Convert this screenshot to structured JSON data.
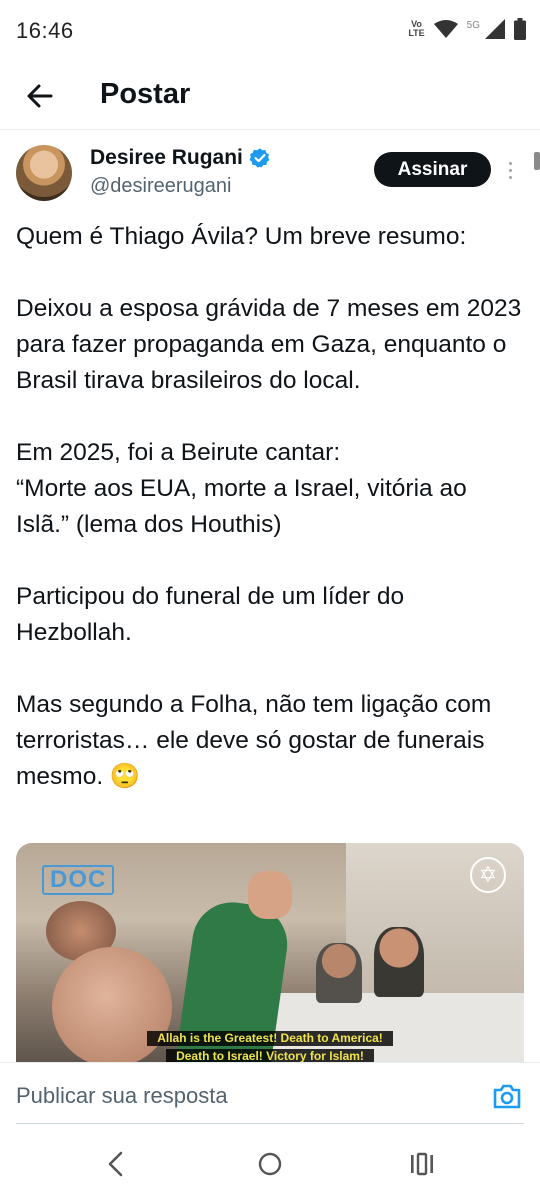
{
  "status_bar": {
    "time": "16:46",
    "volte_label": "Vo\nLTE",
    "network": "5G",
    "icons": [
      "volte-icon",
      "wifi-icon",
      "signal-icon",
      "battery-icon"
    ]
  },
  "header": {
    "back_icon": "arrow-left-icon",
    "title": "Postar"
  },
  "post": {
    "author_name": "Desiree Rugani",
    "verified": true,
    "handle": "@desireerugani",
    "subscribe_label": "Assinar",
    "paragraphs": [
      "Quem é Thiago Ávila? Um breve resumo:",
      "",
      "Deixou a esposa grávida de 7 meses em 2023 para fazer propaganda em Gaza, enquanto o Brasil tirava brasileiros do local.",
      "",
      "Em 2025, foi a Beirute cantar:",
      "“Morte aos EUA, morte a Israel, vitória ao Islã.” (lema dos Houthis)",
      "",
      "Participou do funeral de um líder do Hezbollah.",
      "",
      "Mas segundo a Folha, não tem ligação com terroristas… ele deve só gostar de funerais mesmo. 🙄"
    ],
    "media": {
      "logo_text": "DOC",
      "subtitle_line1": "Allah is the Greatest! Death to America!",
      "subtitle_line2": "Death to Israel! Victory for Islam!"
    }
  },
  "reply": {
    "placeholder": "Publicar sua resposta",
    "camera_icon": "camera-icon"
  },
  "nav": {
    "back_icon": "nav-back-icon",
    "home_icon": "nav-home-icon",
    "recents_icon": "nav-recents-icon"
  },
  "colors": {
    "text": "#0f1419",
    "secondary": "#536471",
    "verified": "#1d9bf0",
    "camera": "#1d9bf0"
  }
}
